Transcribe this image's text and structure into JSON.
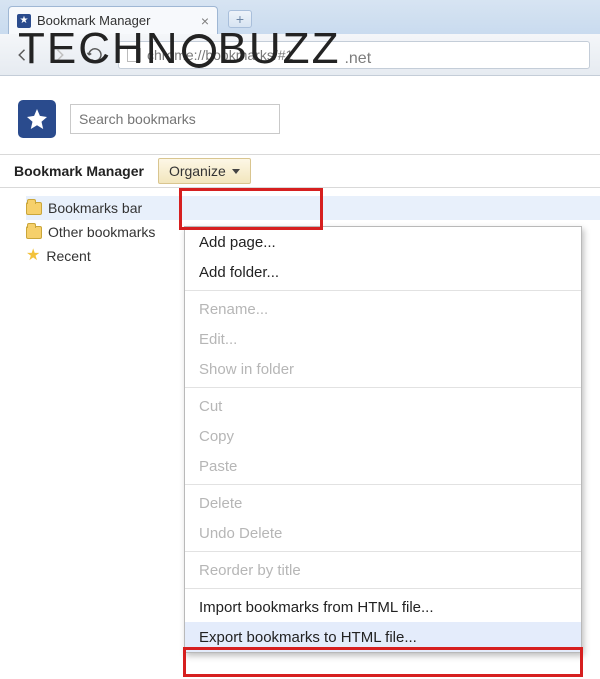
{
  "tab": {
    "title": "Bookmark Manager"
  },
  "omnibox": {
    "url": "chrome://bookmarks/#1"
  },
  "watermark": {
    "left": "TECHN",
    "right": "BUZZ",
    "suffix": ".net"
  },
  "search": {
    "placeholder": "Search bookmarks"
  },
  "subheader": {
    "title": "Bookmark Manager",
    "organize_label": "Organize"
  },
  "tree": [
    {
      "icon": "folder",
      "label": "Bookmarks bar",
      "selected": true
    },
    {
      "icon": "folder",
      "label": "Other bookmarks",
      "selected": false
    },
    {
      "icon": "star",
      "label": "Recent",
      "selected": false
    }
  ],
  "menu": [
    {
      "type": "item",
      "label": "Add page...",
      "enabled": true
    },
    {
      "type": "item",
      "label": "Add folder...",
      "enabled": true
    },
    {
      "type": "sep"
    },
    {
      "type": "item",
      "label": "Rename...",
      "enabled": false
    },
    {
      "type": "item",
      "label": "Edit...",
      "enabled": false
    },
    {
      "type": "item",
      "label": "Show in folder",
      "enabled": false
    },
    {
      "type": "sep"
    },
    {
      "type": "item",
      "label": "Cut",
      "enabled": false
    },
    {
      "type": "item",
      "label": "Copy",
      "enabled": false
    },
    {
      "type": "item",
      "label": "Paste",
      "enabled": false
    },
    {
      "type": "sep"
    },
    {
      "type": "item",
      "label": "Delete",
      "enabled": false
    },
    {
      "type": "item",
      "label": "Undo Delete",
      "enabled": false
    },
    {
      "type": "sep"
    },
    {
      "type": "item",
      "label": "Reorder by title",
      "enabled": false
    },
    {
      "type": "sep"
    },
    {
      "type": "item",
      "label": "Import bookmarks from HTML file...",
      "enabled": true
    },
    {
      "type": "item",
      "label": "Export bookmarks to HTML file...",
      "enabled": true,
      "highlight": true
    }
  ]
}
